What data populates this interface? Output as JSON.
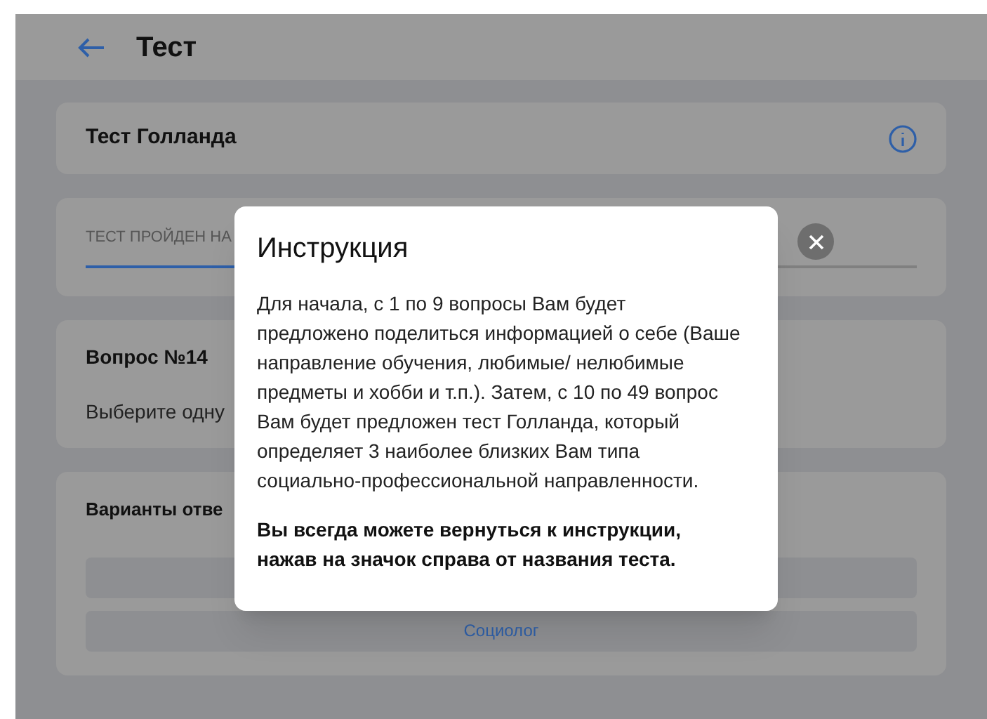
{
  "header": {
    "title": "Тест"
  },
  "test_card": {
    "title": "Тест Голланда"
  },
  "progress_card": {
    "label": "ТЕСТ ПРОЙДЕН НА",
    "level": 0.3
  },
  "question_card": {
    "title": "Вопрос №14",
    "prompt": "Выберите одну"
  },
  "answers_card": {
    "title": "Варианты отве",
    "options": [
      {
        "kind": "blank"
      },
      {
        "kind": "labeled",
        "label": "Социолог"
      }
    ]
  },
  "dialog": {
    "title": "Инструкция",
    "paragraphs": [
      {
        "text": "Для начала, с 1 по 9 вопросы Вам будет предложено поделиться информацией о себе (Ваше направление обучения, любимые/ нелюбимые предметы и хобби и т.п.). Затем, с 10 по 49 вопрос Вам будет предложен тест Голланда, который определяет 3 наиболее близких Вам типа социально-профессиональной направленности.",
        "bold": false
      },
      {
        "text": "Вы всегда можете вернуться к инструкции, нажав на значок справа от названия теста.",
        "bold": true
      }
    ]
  }
}
